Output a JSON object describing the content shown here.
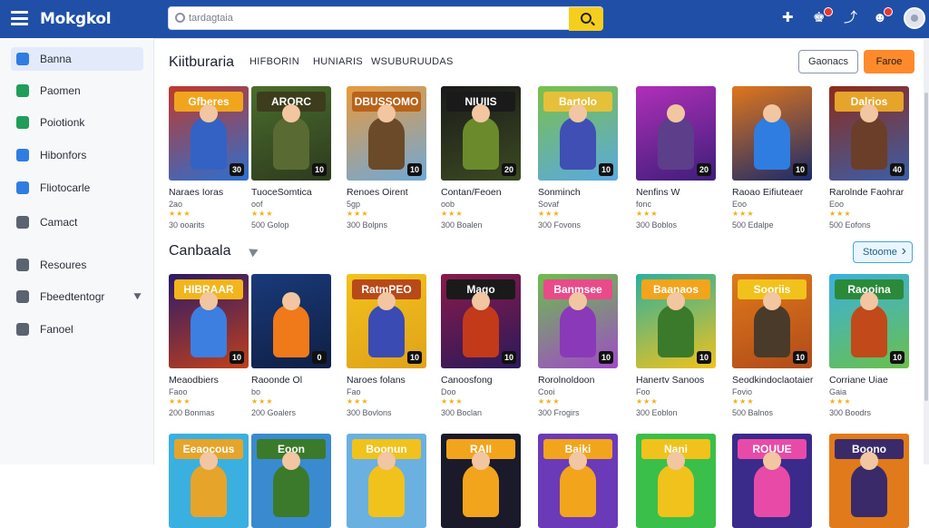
{
  "header": {
    "logo": "Mokgkol",
    "search_placeholder": "tardagtaia",
    "brand_color": "#1f4fa6",
    "icons": [
      "menu-icon",
      "game-controller-icon",
      "notification-icon",
      "share-icon",
      "chat-icon",
      "settings-icon"
    ]
  },
  "sidebar": {
    "items": [
      {
        "label": "Banna",
        "icon": "home-icon",
        "color": "#2f7de1",
        "active": true
      },
      {
        "label": "Paomen",
        "icon": "up-arrow-icon",
        "color": "#1e9e5a",
        "active": false
      },
      {
        "label": "Poiotionk",
        "icon": "puzzle-icon",
        "color": "#1e9e5a",
        "active": false
      },
      {
        "label": "Hibonfors",
        "icon": "folder-icon",
        "color": "#2f7de1",
        "active": false
      },
      {
        "label": "Fliotocarle",
        "icon": "bookmark-icon",
        "color": "#2f7de1",
        "active": false
      },
      {
        "label": "Camact",
        "icon": "controller-icon",
        "color": "#5c6370",
        "active": false
      },
      {
        "label": "Resoures",
        "icon": "resources-icon",
        "color": "#5c6370",
        "active": false
      },
      {
        "label": "Fbeedtentogr",
        "icon": "feedback-icon",
        "color": "#5c6370",
        "active": false
      },
      {
        "label": "Fanoel",
        "icon": "panel-icon",
        "color": "#5c6370",
        "active": false
      }
    ]
  },
  "section1": {
    "title": "Kiitburaria",
    "tabs": [
      "HIFBORIN",
      "HUNIARIS",
      "WSUBURUUDAS"
    ],
    "btn_outline": "Gaonacs",
    "btn_primary": "Faroe",
    "cards": [
      {
        "title": "Naraes Ioras",
        "sub": "2ao",
        "meta": "30 ooarits",
        "band": "Gfberes",
        "num": "30",
        "bg": "#c0392b",
        "bg2": "#2c6fd1",
        "fig": "#3461c4",
        "bandc": "#f0a51c"
      },
      {
        "title": "TuoceSomtica",
        "sub": "oof",
        "meta": "500 Golop",
        "band": "ARORC",
        "num": "10",
        "bg": "#4a6d2c",
        "bg2": "#2d3a1e",
        "fig": "#596b32",
        "bandc": "#3d3d1e"
      },
      {
        "title": "Renoes Oirent",
        "sub": "5gp",
        "meta": "300 Bolpns",
        "band": "DBUSSOMO",
        "num": "10",
        "bg": "#e89a3c",
        "bg2": "#6fa8d8",
        "fig": "#6b4a2a",
        "bandc": "#b8621a"
      },
      {
        "title": "Contan/Feoen",
        "sub": "oob",
        "meta": "300 Boalen",
        "band": "NIUIIS",
        "num": "20",
        "bg": "#1a1a1a",
        "bg2": "#3c4a22",
        "fig": "#6a8a2c",
        "bandc": "#1a1a1a"
      },
      {
        "title": "Sonminch",
        "sub": "Sovaf",
        "meta": "300 Fovons",
        "band": "Bartolo",
        "num": "10",
        "bg": "#7ac04a",
        "bg2": "#5aa9e0",
        "fig": "#3f4fb4",
        "bandc": "#e7c03a"
      },
      {
        "title": "Nenfins W",
        "sub": "fonc",
        "meta": "300 Boblos",
        "band": "",
        "num": "20",
        "bg": "#b02fb8",
        "bg2": "#3d1e7a",
        "fig": "#5c3e8a",
        "bandc": "#b02fb8"
      },
      {
        "title": "Raoao Eifiuteaer",
        "sub": "Eoo",
        "meta": "500 Edalpe",
        "band": "",
        "num": "10",
        "bg": "#e0761c",
        "bg2": "#1a2a6a",
        "fig": "#2f7de1",
        "bandc": "#e0761c"
      },
      {
        "title": "Rarolnde Faohrar",
        "sub": "Eoo",
        "meta": "500 Eofons",
        "band": "Dalrios",
        "num": "40",
        "bg": "#8e2b1a",
        "bg2": "#3a5ea8",
        "fig": "#6b3e2a",
        "bandc": "#e6a52a"
      }
    ]
  },
  "section2": {
    "title": "Canbaala",
    "btn": "Stoome",
    "cards": [
      {
        "title": "Meaodbiers",
        "sub": "Faoo",
        "meta": "200 Bonmas",
        "band": "HIBRAAR",
        "num": "10",
        "bg": "#2a1a6a",
        "bg2": "#c0401a",
        "fig": "#3d7ee1",
        "bandc": "#f2b51c"
      },
      {
        "title": "Raoonde Ol",
        "sub": "bo",
        "meta": "200 Goalers",
        "band": "",
        "num": "0",
        "bg": "#1a3a7a",
        "bg2": "#0f1f44",
        "fig": "#f07a1a",
        "bandc": "#1a3a7a"
      },
      {
        "title": "Naroes folans",
        "sub": "Fao",
        "meta": "300 Bovlons",
        "band": "RatmPEO",
        "num": "10",
        "bg": "#f2c21c",
        "bg2": "#e0a21a",
        "fig": "#3a4bb4",
        "bandc": "#b84a1a"
      },
      {
        "title": "Canoosfong",
        "sub": "Doo",
        "meta": "300 Boclan",
        "band": "Mago",
        "num": "10",
        "bg": "#8a1a4a",
        "bg2": "#2a1a5a",
        "fig": "#c23a1a",
        "bandc": "#1a1a1a"
      },
      {
        "title": "Rorolnoldoon",
        "sub": "Cooi",
        "meta": "300 Frogirs",
        "band": "Banmsee",
        "num": "10",
        "bg": "#6ac04a",
        "bg2": "#a04ac8",
        "fig": "#8a3ab8",
        "bandc": "#e84a8a"
      },
      {
        "title": "Hanertv Sanoos",
        "sub": "Foo",
        "meta": "300 Eoblon",
        "band": "Baanaos",
        "num": "10",
        "bg": "#2ab0a0",
        "bg2": "#f0c21c",
        "fig": "#3a7a2a",
        "bandc": "#f2a51c"
      },
      {
        "title": "Seodkindoclaotaier",
        "sub": "Fovio",
        "meta": "500 Balnos",
        "band": "Sooriis",
        "num": "10",
        "bg": "#e07a1a",
        "bg2": "#b04a1a",
        "fig": "#4a3a2a",
        "bandc": "#f2c21c"
      },
      {
        "title": "Corriane Uiae",
        "sub": "Gaia",
        "meta": "300 Boodrs",
        "band": "Raooina",
        "num": "10",
        "bg": "#3ab0e0",
        "bg2": "#6ac04a",
        "fig": "#c24a1a",
        "bandc": "#2a8a3a"
      }
    ]
  },
  "section3": {
    "cards": [
      {
        "band": "Eeaocous",
        "bg": "#3ab0e0",
        "bandc": "#e6a52a"
      },
      {
        "band": "Eoon",
        "bg": "#3a8ad0",
        "bandc": "#3a7a2a"
      },
      {
        "band": "Boonun",
        "bg": "#6ab0e0",
        "bandc": "#f2c21c"
      },
      {
        "band": "RAII",
        "bg": "#1a1a2a",
        "bandc": "#f2a51c"
      },
      {
        "band": "Baiki",
        "bg": "#6a3ab8",
        "bandc": "#f2a51c"
      },
      {
        "band": "Nani",
        "bg": "#3ac04a",
        "bandc": "#f2c21c"
      },
      {
        "band": "ROUUE",
        "bg": "#3a2a8a",
        "bandc": "#e84aa8"
      },
      {
        "band": "Boono",
        "bg": "#e07a1a",
        "bandc": "#3a2a6a"
      }
    ]
  }
}
